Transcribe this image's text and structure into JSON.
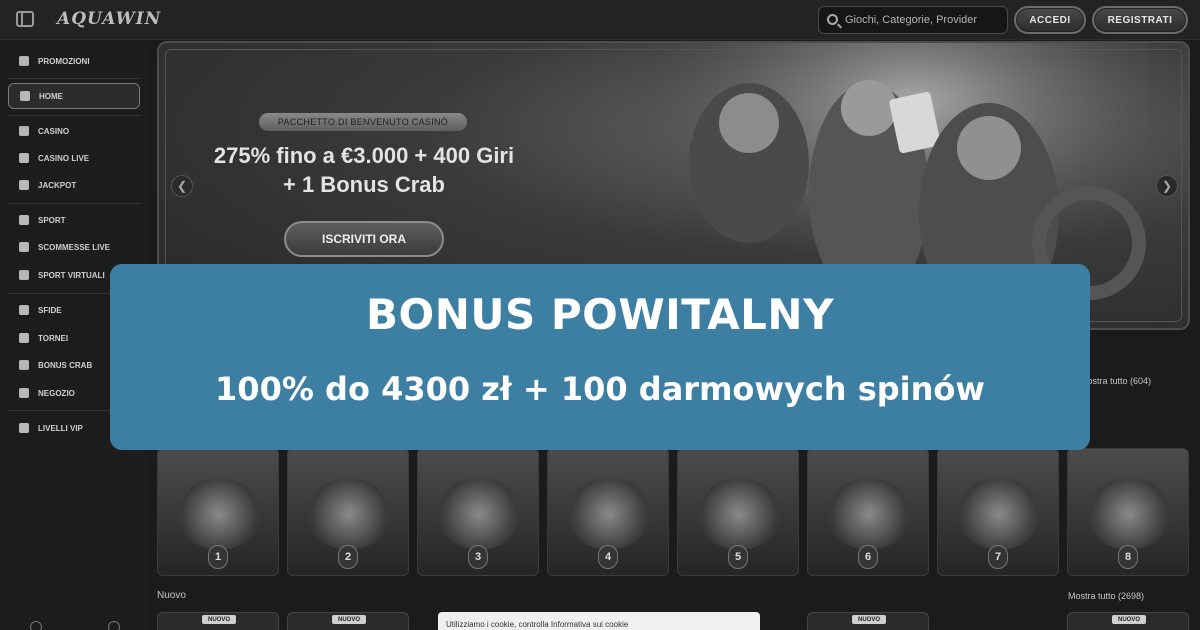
{
  "header": {
    "logo": "AQUAWIN",
    "search_placeholder": "Giochi, Categorie, Provider",
    "login_label": "ACCEDI",
    "register_label": "REGISTRATI"
  },
  "sidebar": {
    "items": [
      {
        "label": "PROMOZIONI",
        "icon": "gift-icon"
      },
      {
        "label": "HOME",
        "icon": "home-icon",
        "active": true
      },
      {
        "label": "CASINO",
        "icon": "casino-icon"
      },
      {
        "label": "CASINO LIVE",
        "icon": "live-casino-icon"
      },
      {
        "label": "JACKPOT",
        "icon": "jackpot-icon"
      },
      {
        "label": "SPORT",
        "icon": "sport-icon"
      },
      {
        "label": "SCOMMESSE LIVE",
        "icon": "live-bets-icon"
      },
      {
        "label": "SPORT VIRTUALI",
        "icon": "virtual-sport-icon"
      },
      {
        "label": "SFIDE",
        "icon": "challenge-icon"
      },
      {
        "label": "TORNEI",
        "icon": "trophy-icon"
      },
      {
        "label": "BONUS CRAB",
        "icon": "crab-icon"
      },
      {
        "label": "NEGOZIO",
        "icon": "shop-icon"
      },
      {
        "label": "LIVELLI VIP",
        "icon": "diamond-icon"
      }
    ]
  },
  "hero": {
    "badge": "PACCHETTO DI BENVENUTO CASINÒ",
    "title": "275% fino a €3.000 + 400 Giri + 1 Bonus Crab",
    "cta": "ISCRIVITI ORA"
  },
  "top_games": {
    "show_all": "Mostra tutto (604)",
    "numbers": [
      "1",
      "2",
      "3",
      "4",
      "5",
      "6",
      "7",
      "8"
    ]
  },
  "new_games": {
    "heading": "Nuovo",
    "show_all": "Mostra tutto (2698)",
    "tag": "NUOVO"
  },
  "cookie_text": "Utilizziamo i cookie, controlla Informativa sui cookie",
  "promo": {
    "title": "BONUS POWITALNY",
    "subtitle": "100% do 4300 zł + 100 darmowych spinów"
  },
  "colors": {
    "promo_bg": "#3d7fa3",
    "promo_text": "#ffffff",
    "page_bg": "#1b1b1b"
  }
}
